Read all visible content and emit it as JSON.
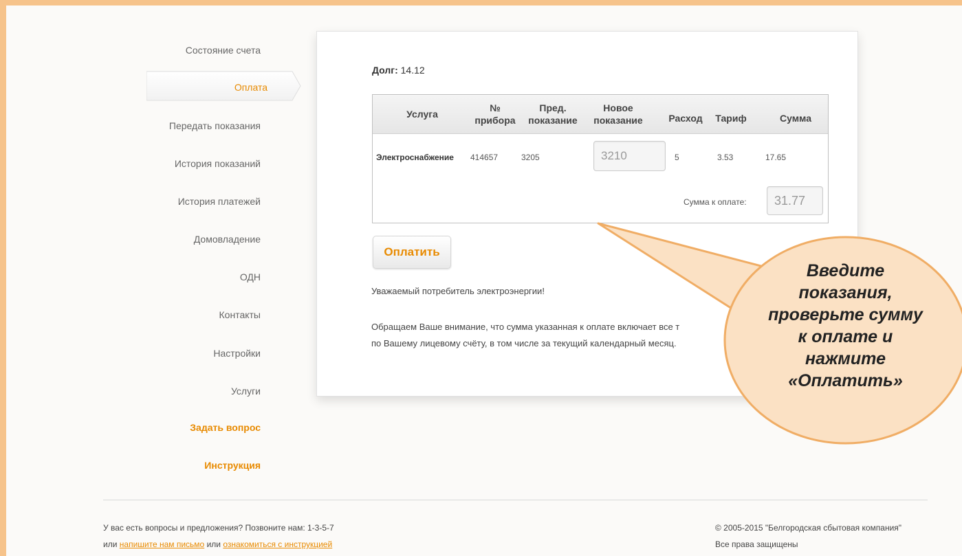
{
  "sidebar": {
    "items": [
      {
        "label": "Состояние счета"
      },
      {
        "label": "Оплата"
      },
      {
        "label": "Передать показания"
      },
      {
        "label": "История показаний"
      },
      {
        "label": "История платежей"
      },
      {
        "label": "Домовладение"
      },
      {
        "label": "ОДН"
      },
      {
        "label": "Контакты"
      },
      {
        "label": "Настройки"
      },
      {
        "label": "Услуги"
      }
    ],
    "ask_label": "Задать вопрос",
    "guide_label": "Инструкция"
  },
  "main": {
    "debt_label": "Долг:",
    "debt_value": "14.12",
    "table": {
      "headers": {
        "service": "Услуга",
        "meter_1": "№",
        "meter_2": "прибора",
        "prev_1": "Пред.",
        "prev_2": "показание",
        "new_1": "Новое",
        "new_2": "показание",
        "usage": "Расход",
        "tariff": "Тариф",
        "sum": "Сумма"
      },
      "rows": [
        {
          "service": "Электроснабжение",
          "meter": "414657",
          "prev": "3205",
          "new": "3210",
          "usage": "5",
          "tariff": "3.53",
          "sum": "17.65"
        }
      ],
      "total_label": "Сумма к оплате:",
      "total_value": "31.77"
    },
    "pay_button": "Оплатить",
    "message_1": "Уважаемый потребитель электроэнергии!",
    "message_2a": "Обращаем Ваше внимание, что сумма указанная к оплате включает все т",
    "message_2b": "по Вашему лицевому счёту, в том числе за текущий календарный месяц."
  },
  "footer": {
    "line1": "У вас есть вопросы и предложения? Позвоните нам: 1-3-5-7",
    "or1": "или",
    "link_write": "напишите нам письмо",
    "or2": "или",
    "link_guide": "ознакомиться с инструкцией",
    "copyright": "© 2005-2015 \"Белгородская сбытовая компания\"",
    "rights": "Все права защищены"
  },
  "callout": {
    "lines": [
      "Введите",
      "показания,",
      "проверьте сумму",
      "к оплате и",
      "нажмите",
      "«Оплатить»"
    ]
  },
  "colors": {
    "accent": "#e88a00",
    "frame": "#f6c38b",
    "callout_fill": "#fbe1c4"
  }
}
